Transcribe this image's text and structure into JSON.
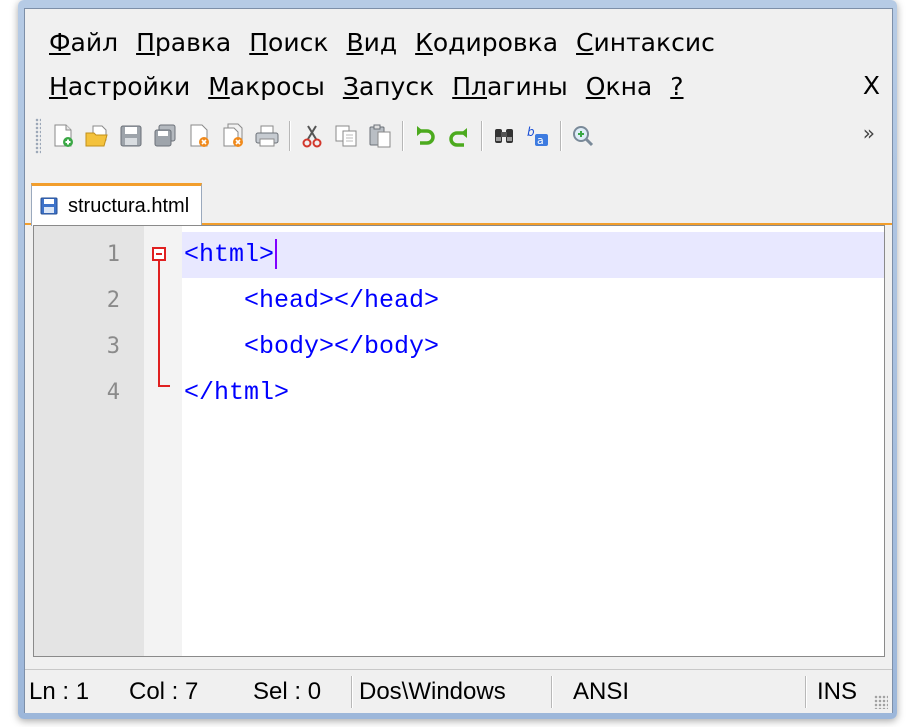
{
  "menu": {
    "row1": [
      {
        "underline": "Ф",
        "rest": "айл"
      },
      {
        "underline": "П",
        "rest": "равка"
      },
      {
        "underline": "П",
        "rest": "оиск"
      },
      {
        "underline": "В",
        "rest": "ид"
      },
      {
        "underline": "К",
        "rest": "одировка"
      },
      {
        "underline": "С",
        "rest": "интаксис"
      }
    ],
    "row2": [
      {
        "underline": "Н",
        "rest": "астройки"
      },
      {
        "underline": "М",
        "rest": "акросы"
      },
      {
        "underline": "З",
        "rest": "апуск"
      },
      {
        "underline": "Пл",
        "rest": "агины"
      },
      {
        "underline": "О",
        "rest": "кна"
      },
      {
        "underline": "?",
        "rest": ""
      }
    ],
    "close": "X"
  },
  "toolbar": {
    "overflow": "»",
    "icons": [
      "new-file-icon",
      "open-file-icon",
      "save-icon",
      "save-all-icon",
      "close-icon",
      "close-all-icon",
      "print-icon",
      "cut-icon",
      "copy-icon",
      "paste-icon",
      "undo-icon",
      "redo-icon",
      "find-icon",
      "replace-icon",
      "zoom-in-icon"
    ]
  },
  "tabs": [
    {
      "label": "structura.html",
      "icon": "saved-file-icon"
    }
  ],
  "editor": {
    "lines": [
      {
        "number": "1",
        "text": "<html>"
      },
      {
        "number": "2",
        "text": "    <head></head>"
      },
      {
        "number": "3",
        "text": "    <body></body>"
      },
      {
        "number": "4",
        "text": "</html>"
      }
    ],
    "current_line_color": "#e8e8ff",
    "tag_color": "#0000ff",
    "fold_color": "#e02020"
  },
  "status": {
    "ln": "Ln : 1",
    "col": "Col : 7",
    "sel": "Sel : 0",
    "eol": "Dos\\Windows",
    "encoding": "ANSI",
    "mode": "INS"
  },
  "colors": {
    "tab_accent": "#f29e2c",
    "window_frame": "#9db7da"
  }
}
